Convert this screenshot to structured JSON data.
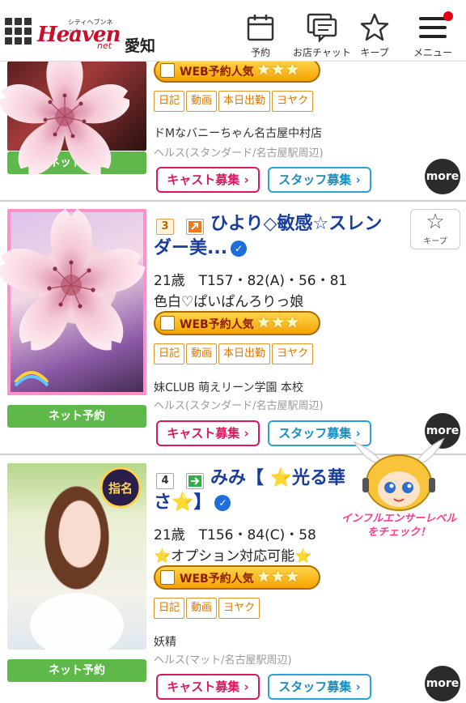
{
  "header": {
    "logo_text": "Heaven",
    "logo_small_text": "シティヘブンネット",
    "logo_net": "net",
    "area": "愛知",
    "nav": [
      {
        "label": "予約",
        "icon": "calendar-icon"
      },
      {
        "label": "お店チャット",
        "icon": "chat-icon"
      },
      {
        "label": "キープ",
        "icon": "star-icon"
      },
      {
        "label": "メニュー",
        "icon": "hamburger-icon"
      }
    ]
  },
  "common": {
    "web_badge": "WEB予約人気",
    "net_reserve": "ネット予約",
    "cast_recruit": "キャスト募集 ›",
    "staff_recruit": "スタッフ募集 ›",
    "more": "more",
    "keep": "キープ"
  },
  "cards": [
    {
      "tags": [
        "日記",
        "動画",
        "本日出勤",
        "ヨヤク"
      ],
      "shop": "ドMなバニーちゃん名古屋中村店",
      "genre": "ヘルス(スタンダード/名古屋駅周辺)"
    },
    {
      "rank": "3",
      "name": "ひより◇敏感☆スレンダー美...",
      "stats": "21歳　T157・82(A)・56・81",
      "catch": "色白♡ぱいぱんろりっ娘",
      "tags": [
        "日記",
        "動画",
        "本日出勤",
        "ヨヤク"
      ],
      "shop": "妹CLUB 萌えリーン学園 本校",
      "genre": "ヘルス(スタンダード/名古屋駅周辺)"
    },
    {
      "rank": "4",
      "name": "みみ【 ⭐光る華さ⭐】",
      "stats": "21歳　T156・84(C)・58",
      "catch": "⭐オプション対応可能⭐",
      "thumb_badge": "指名",
      "tags": [
        "日記",
        "動画",
        "ヨヤク"
      ],
      "shop": "妖精",
      "genre": "ヘルス(マット/名古屋駅周辺)"
    }
  ],
  "influencer_banner": "インフルエンサーレベルをチェック！",
  "colors": {
    "brand_red": "#c8102e",
    "name_blue": "#1a3d9c",
    "net_green": "#5fb94a",
    "cast_pink": "#d81b60",
    "staff_blue": "#29a3d6",
    "tag_orange": "#d97700"
  }
}
